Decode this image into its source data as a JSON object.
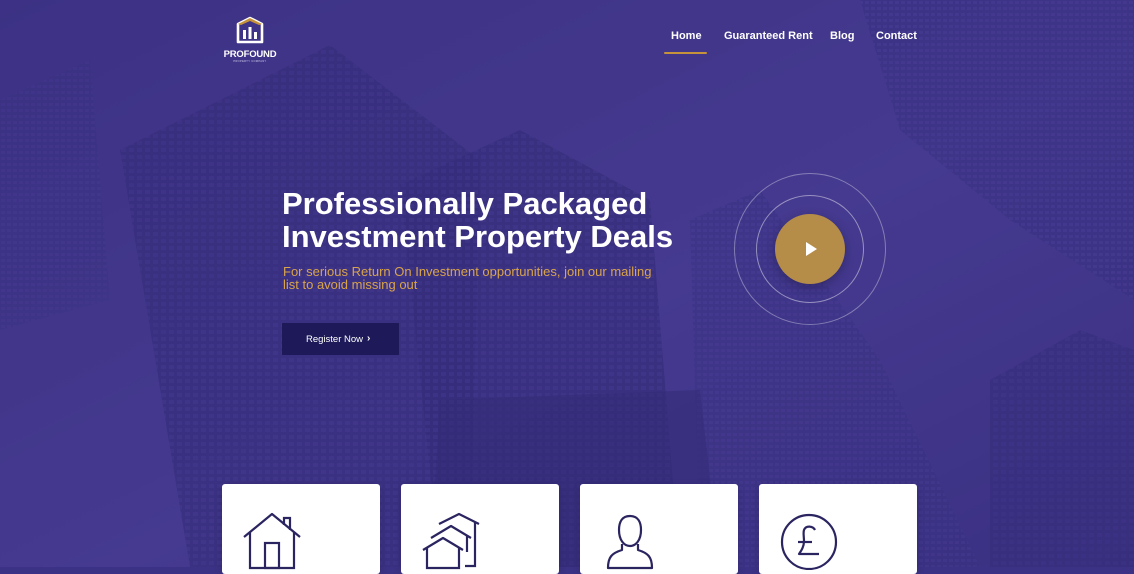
{
  "brand": {
    "name": "PROFOUND",
    "tagline": "PROPERTY COMPANY"
  },
  "nav": {
    "items": [
      {
        "label": "Home",
        "active": true
      },
      {
        "label": "Guaranteed Rent",
        "active": false
      },
      {
        "label": "Blog",
        "active": false
      },
      {
        "label": "Contact",
        "active": false
      }
    ]
  },
  "hero": {
    "headline_line1": "Professionally Packaged",
    "headline_line2": "Investment Property Deals",
    "subtext_line1": "For serious Return On Investment opportunities, join our mailing",
    "subtext_line2": "list to avoid missing out",
    "cta_label": "Register Now",
    "cta_icon": "chevron-right-icon",
    "video_icon": "play-icon"
  },
  "features": {
    "cards": [
      {
        "icon": "house-icon"
      },
      {
        "icon": "multiple-houses-icon"
      },
      {
        "icon": "person-icon"
      },
      {
        "icon": "pound-coin-icon"
      }
    ]
  },
  "colors": {
    "hero_overlay": "#3c3285",
    "accent_gold": "#c7933a",
    "subtext_gold": "#d9a44b",
    "button_navy": "#1e1a5a",
    "icon_navy": "#2a2460"
  }
}
